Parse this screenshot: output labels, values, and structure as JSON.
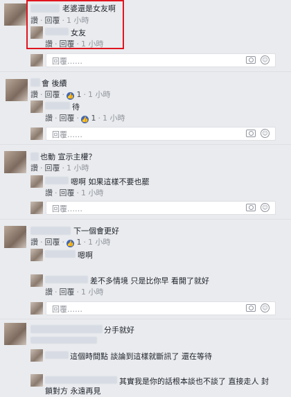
{
  "reply_placeholder": "回覆……",
  "like_label": "讚",
  "reply_label": "回覆",
  "dot": "·",
  "comments": [
    {
      "id": "c1",
      "text": "老婆還是女友啊",
      "time": "1 小時",
      "replies": [
        {
          "text": "女友",
          "time": "1 小時"
        }
      ]
    },
    {
      "id": "c2",
      "text": "後續",
      "likes": "1",
      "time": "1 小時",
      "replies": [
        {
          "text": "待",
          "likes": "1",
          "time": "1 小時"
        }
      ]
    },
    {
      "id": "c3",
      "text": "宣示主權？",
      "time": "1 小時",
      "replies": [
        {
          "text": "嗯啊 如果這樣不要也罷",
          "time": "1 小時"
        }
      ]
    },
    {
      "id": "c4",
      "text": "下一個會更好",
      "likes": "1",
      "time": "1 小時",
      "replies": [
        {
          "text": "嗯啊"
        },
        {
          "text": "差不多情境 只是比你早 看開了就好",
          "time": "1 小時"
        }
      ]
    },
    {
      "id": "c5",
      "text": "分手就好",
      "replies": [
        {
          "text": "這個時間點 談論到這樣就斷訊了 還在等待"
        },
        {
          "text_line1": "其實我是你的話根本談也不談了 直接走人 封",
          "text_line2": "鎖對方 永遠再見"
        }
      ]
    }
  ],
  "partial_prefixes": {
    "c2": "會",
    "c3": "也動"
  }
}
